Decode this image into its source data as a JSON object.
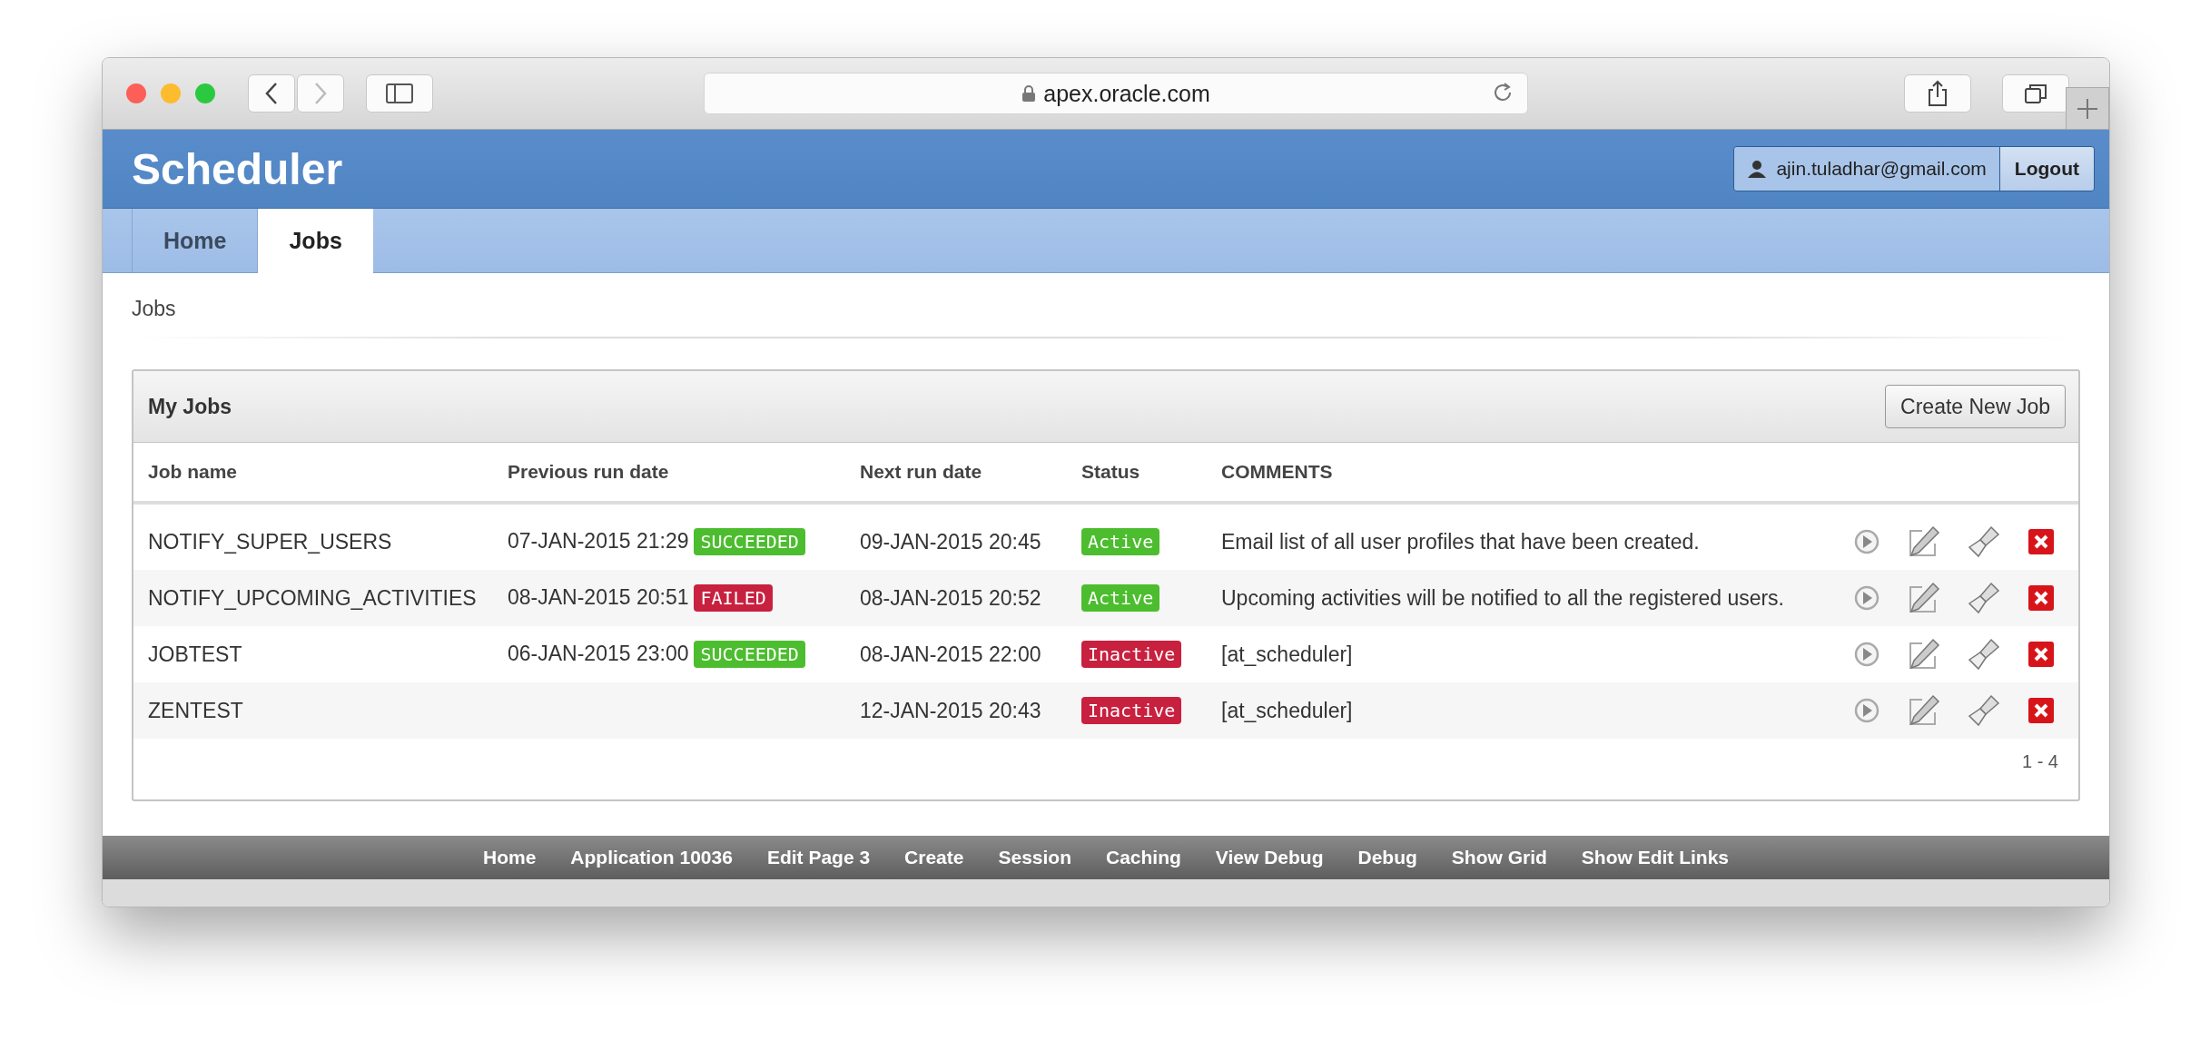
{
  "browser": {
    "address": "apex.oracle.com"
  },
  "header": {
    "title": "Scheduler",
    "user": "ajin.tuladhar@gmail.com",
    "logout": "Logout"
  },
  "tabs": [
    {
      "label": "Home",
      "selected": false
    },
    {
      "label": "Jobs",
      "selected": true
    }
  ],
  "breadcrumb": "Jobs",
  "panel": {
    "title": "My Jobs",
    "create_button": "Create New Job",
    "columns": [
      "Job name",
      "Previous run date",
      "Next run date",
      "Status",
      "COMMENTS"
    ],
    "rows": [
      {
        "name": "NOTIFY_SUPER_USERS",
        "previous": "07-JAN-2015 21:29",
        "result": {
          "text": "SUCCEEDED",
          "kind": "success"
        },
        "next": "09-JAN-2015 20:45",
        "status": {
          "text": "Active",
          "active": true
        },
        "comment": "Email list of all user profiles that have been created."
      },
      {
        "name": "NOTIFY_UPCOMING_ACTIVITIES",
        "previous": "08-JAN-2015 20:51",
        "result": {
          "text": "FAILED",
          "kind": "failure"
        },
        "next": "08-JAN-2015 20:52",
        "status": {
          "text": "Active",
          "active": true
        },
        "comment": "Upcoming activities will be notified to all the registered users."
      },
      {
        "name": "JOBTEST",
        "previous": "06-JAN-2015 23:00",
        "result": {
          "text": "SUCCEEDED",
          "kind": "success"
        },
        "next": "08-JAN-2015 22:00",
        "status": {
          "text": "Inactive",
          "active": false
        },
        "comment": "[at_scheduler]"
      },
      {
        "name": "ZENTEST",
        "next": "12-JAN-2015 20:43",
        "status": {
          "text": "Inactive",
          "active": false
        },
        "comment": "[at_scheduler]"
      }
    ],
    "pagination": "1 - 4"
  },
  "footer_links": [
    "Home",
    "Application 10036",
    "Edit Page 3",
    "Create",
    "Session",
    "Caching",
    "View Debug",
    "Debug",
    "Show Grid",
    "Show Edit Links"
  ]
}
